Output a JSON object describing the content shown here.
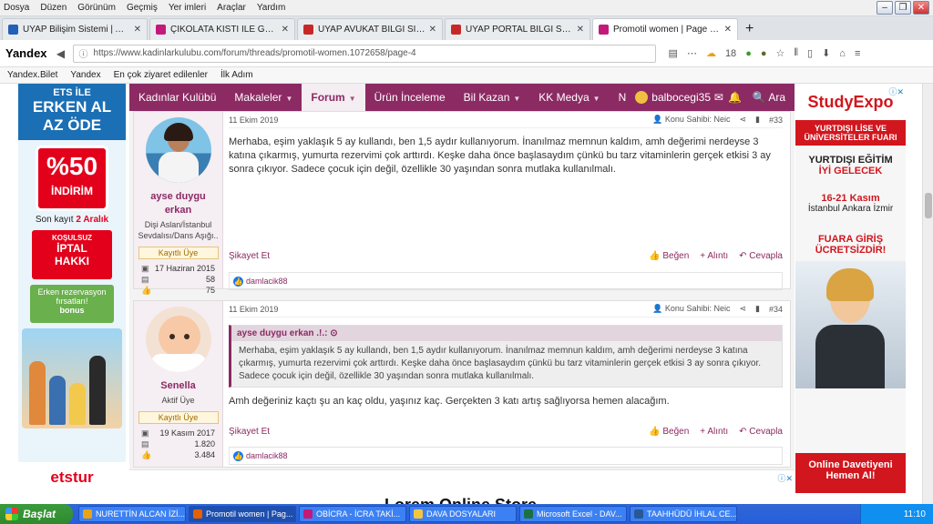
{
  "menubar": {
    "items": [
      "Dosya",
      "Düzen",
      "Görünüm",
      "Geçmiş",
      "Yer imleri",
      "Araçlar",
      "Yardım"
    ]
  },
  "tabs": [
    {
      "title": "UYAP Bilişim Sistemi | Ana Say...",
      "color": "#2460b8"
    },
    {
      "title": "ÇİKOLATA KİSTİ İLE GEBE KA...",
      "color": "#c2197a"
    },
    {
      "title": "UYAP AVUKAT BİLGİ SİSTEMİ",
      "color": "#c62828"
    },
    {
      "title": "UYAP PORTAL BİLGİ SİSTEMİ",
      "color": "#c62828"
    },
    {
      "title": "Promotil women | Page 4 | Ka...",
      "color": "#c2197a"
    }
  ],
  "navbar": {
    "browser": "Yandex",
    "url": "https://www.kadinlarkulubu.com/forum/threads/promotil-women.1072658/page-4",
    "weather": "18"
  },
  "bookmarks": [
    "Yandex.Bilet",
    "Yandex",
    "En çok ziyaret edilenler",
    "İlk Adım"
  ],
  "site_nav": {
    "items": [
      "Kadınlar Kulübü",
      "Makaleler",
      "Forum",
      "Ürün İnceleme",
      "Bil Kazan",
      "KK Medya",
      "N"
    ],
    "user": "balbocegi35",
    "search": "Ara"
  },
  "ad_left": {
    "top1": "ETS İLE",
    "top2": "ERKEN AL",
    "top3": "AZ ÖDE",
    "pct": "%50",
    "pct_label": "İNDİRİM",
    "son": "Son kayıt",
    "son_date": "2 Aralık",
    "box_small": "KOŞULSUZ",
    "box_big1": "İPTAL",
    "box_big2": "HAKKI",
    "erken": "Erken rezervasyon fırsatları!",
    "erken2": "bonus",
    "logo": "etstur"
  },
  "ad_right": {
    "logo": "StudyExpo",
    "banner": "YURTDIŞI LİSE VE ÜNİVERSİTELER FUARI",
    "t1": "YURTDIŞI EĞİTİM",
    "t2": "İYİ GELECEK",
    "dates": "16-21 Kasım",
    "cities": "İstanbul Ankara İzmir",
    "free1": "FUARA GİRİŞ",
    "free2": "ÜCRETSİZDİR!",
    "cta1": "Online Davetiyeni",
    "cta2": "Hemen Al!"
  },
  "posts": [
    {
      "date": "11 Ekim 2019",
      "author_label": "Konu Sahibi: Neic",
      "num": "#33",
      "user": {
        "name1": "ayse duygu",
        "name2": "erkan",
        "title1": "Dişi Aslan/İstanbul",
        "title2": "Sevdalısı/Dans Aşığı..",
        "badge": "Kayıtlı Üye",
        "joined": "17 Haziran 2015",
        "messages": "58",
        "reactions": "75"
      },
      "text": "Merhaba, eşim yaklaşık 5 ay kullandı, ben 1,5 aydır kullanıyorum. İnanılmaz memnun kaldım, amh değerimi nerdeyse 3 katına çıkarmış, yumurta rezervimi çok arttırdı. Keşke daha önce başlasaydım çünkü bu tarz vitaminlerin gerçek etkisi 3 ay sonra çıkıyor. Sadece çocuk için değil, özellikle 30 yaşından sonra mutlaka kullanılmalı.",
      "report": "Şikayet Et",
      "like": "Beğen",
      "quote": "+ Alıntı",
      "reply": "Cevapla",
      "liker": "damlacik88"
    },
    {
      "date": "11 Ekim 2019",
      "author_label": "Konu Sahibi: Neic",
      "num": "#34",
      "user": {
        "name1": "Senella",
        "title1": "Aktif Üye",
        "badge": "Kayıtlı Üye",
        "joined": "19 Kasım 2017",
        "messages": "1.820",
        "reactions": "3.484"
      },
      "quote_author": "ayse duygu erkan .!.:",
      "quote_text": "Merhaba, eşim yaklaşık 5 ay kullandı, ben 1,5 aydır kullanıyorum. İnanılmaz memnun kaldım, amh değerimi nerdeyse 3 katına çıkarmış, yumurta rezervimi çok arttırdı. Keşke daha önce başlasaydım çünkü bu tarz vitaminlerin gerçek etkisi 3 ay sonra çıkıyor. Sadece çocuk için değil, özellikle 30 yaşından sonra mutlaka kullanılmalı.",
      "text": "Amh değeriniz kaçtı şu an kaç oldu, yaşınız kaç. Gerçekten 3 katı artış sağlıyorsa hemen alacağım.",
      "report": "Şikayet Et",
      "like": "Beğen",
      "quote": "+ Alıntı",
      "reply": "Cevapla",
      "liker": "damlacik88"
    }
  ],
  "bottom_ad": "Lorem Online Store",
  "taskbar": {
    "start": "Başlat",
    "items": [
      "NURETTİN ALCAN İZİ...",
      "Promotil women | Pag...",
      "OBİCRA - İCRA TAKİ...",
      "DAVA DOSYALARI",
      "Microsoft Excel - DAV...",
      "TAAHHÜDÜ İHLAL CE..."
    ],
    "time": "11:10"
  }
}
